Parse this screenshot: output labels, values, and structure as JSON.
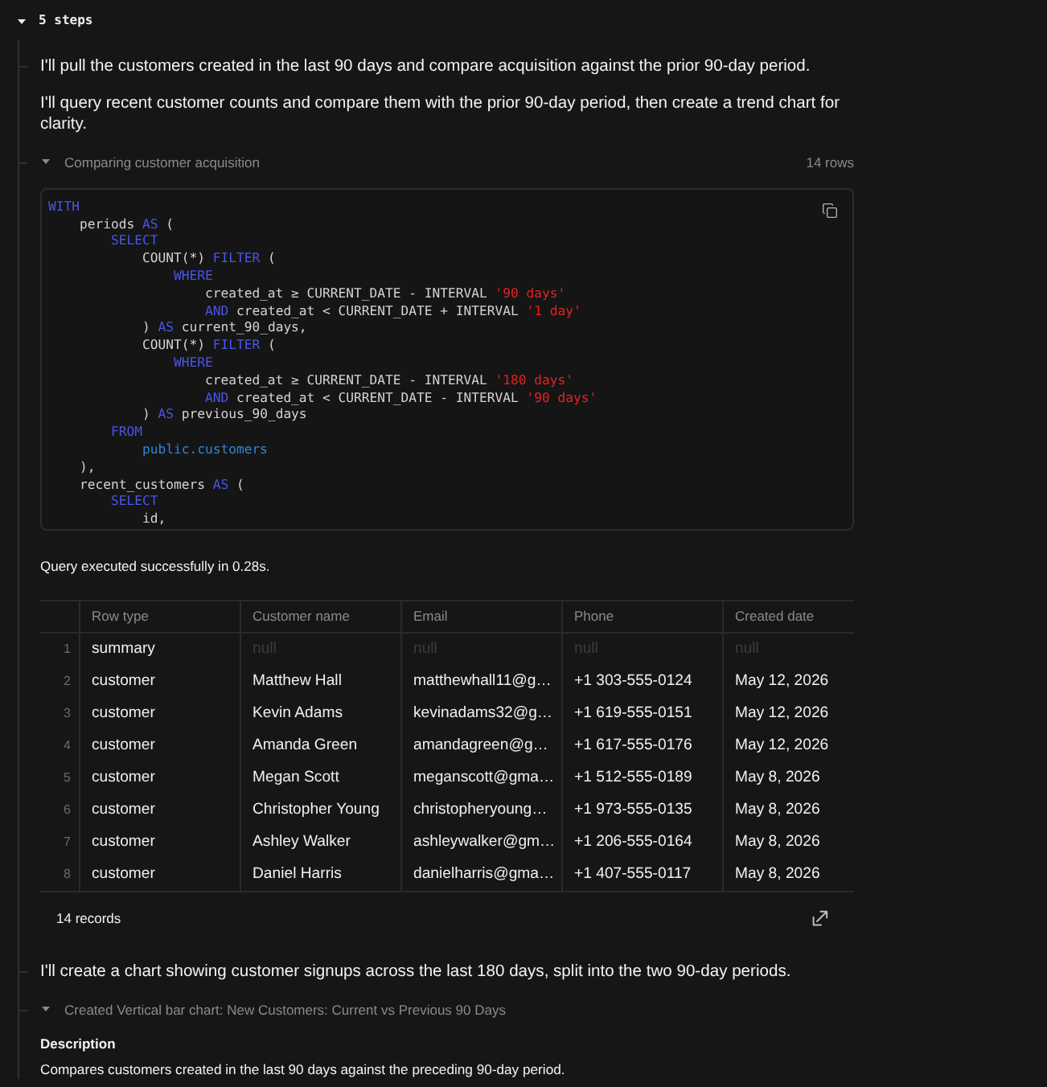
{
  "steps_toggle": {
    "label": "5 steps",
    "expanded": true
  },
  "steps": [
    {
      "kind": "message",
      "paragraphs": [
        "I'll pull the customers created in the last 90 days and compare acquisition against the prior 90-day period.",
        "I'll query recent customer counts and compare them with the prior 90-day period, then create a trend chart for clarity."
      ]
    },
    {
      "kind": "query",
      "title": "Comparing customer acquisition",
      "expanded": true,
      "row_count": "14 rows",
      "code": [
        {
          "tokens": [
            {
              "kind": "keyword",
              "text": "WITH"
            }
          ],
          "children": [
            {
              "tokens": [
                {
                  "kind": "plain",
                  "text": "periods "
                },
                {
                  "kind": "keyword",
                  "text": "AS"
                },
                {
                  "kind": "plain",
                  "text": " ("
                }
              ],
              "children": [
                {
                  "tokens": [
                    {
                      "kind": "keyword",
                      "text": "SELECT"
                    }
                  ],
                  "children": [
                    {
                      "tokens": [
                        {
                          "kind": "plain",
                          "text": "COUNT(*) "
                        },
                        {
                          "kind": "keyword",
                          "text": "FILTER"
                        },
                        {
                          "kind": "plain",
                          "text": " ("
                        }
                      ],
                      "children": [
                        {
                          "tokens": [
                            {
                              "kind": "keyword",
                              "text": "WHERE"
                            }
                          ],
                          "children": [
                            {
                              "tokens": [
                                {
                                  "kind": "plain",
                                  "text": "created_at ≥ CURRENT_DATE - INTERVAL "
                                },
                                {
                                  "kind": "string",
                                  "text": "'90 days'"
                                }
                              ]
                            },
                            {
                              "tokens": [
                                {
                                  "kind": "keyword",
                                  "text": "AND"
                                },
                                {
                                  "kind": "plain",
                                  "text": " created_at < CURRENT_DATE + INTERVAL "
                                },
                                {
                                  "kind": "string",
                                  "text": "'1 day'"
                                }
                              ]
                            }
                          ]
                        }
                      ]
                    },
                    {
                      "tokens": [
                        {
                          "kind": "plain",
                          "text": ") "
                        },
                        {
                          "kind": "keyword",
                          "text": "AS"
                        },
                        {
                          "kind": "plain",
                          "text": " current_90_days,"
                        }
                      ]
                    },
                    {
                      "tokens": [
                        {
                          "kind": "plain",
                          "text": "COUNT(*) "
                        },
                        {
                          "kind": "keyword",
                          "text": "FILTER"
                        },
                        {
                          "kind": "plain",
                          "text": " ("
                        }
                      ],
                      "children": [
                        {
                          "tokens": [
                            {
                              "kind": "keyword",
                              "text": "WHERE"
                            }
                          ],
                          "children": [
                            {
                              "tokens": [
                                {
                                  "kind": "plain",
                                  "text": "created_at ≥ CURRENT_DATE - INTERVAL "
                                },
                                {
                                  "kind": "string",
                                  "text": "'180 days'"
                                }
                              ]
                            },
                            {
                              "tokens": [
                                {
                                  "kind": "keyword",
                                  "text": "AND"
                                },
                                {
                                  "kind": "plain",
                                  "text": " created_at < CURRENT_DATE - INTERVAL "
                                },
                                {
                                  "kind": "string",
                                  "text": "'90 days'"
                                }
                              ]
                            }
                          ]
                        }
                      ]
                    },
                    {
                      "tokens": [
                        {
                          "kind": "plain",
                          "text": ") "
                        },
                        {
                          "kind": "keyword",
                          "text": "AS"
                        },
                        {
                          "kind": "plain",
                          "text": " previous_90_days"
                        }
                      ]
                    }
                  ]
                },
                {
                  "tokens": [
                    {
                      "kind": "keyword",
                      "text": "FROM"
                    }
                  ],
                  "children": [
                    {
                      "tokens": [
                        {
                          "kind": "reference",
                          "text": "public.customers"
                        }
                      ]
                    }
                  ]
                }
              ]
            },
            {
              "tokens": [
                {
                  "kind": "plain",
                  "text": "),"
                }
              ]
            },
            {
              "tokens": [
                {
                  "kind": "plain",
                  "text": "recent_customers "
                },
                {
                  "kind": "keyword",
                  "text": "AS"
                },
                {
                  "kind": "plain",
                  "text": " ("
                }
              ],
              "children": [
                {
                  "tokens": [
                    {
                      "kind": "keyword",
                      "text": "SELECT"
                    }
                  ],
                  "children": [
                    {
                      "tokens": [
                        {
                          "kind": "plain",
                          "text": "id,"
                        }
                      ]
                    }
                  ]
                }
              ]
            }
          ]
        }
      ],
      "status": "Query executed successfully in 0.28s.",
      "table": {
        "columns": [
          "Row type",
          "Customer name",
          "Email",
          "Phone",
          "Created date"
        ],
        "rows": [
          {
            "number": "1",
            "cells": [
              {
                "kind": "value",
                "text": "summary"
              },
              {
                "kind": "null",
                "text": "null"
              },
              {
                "kind": "null",
                "text": "null"
              },
              {
                "kind": "null",
                "text": "null"
              },
              {
                "kind": "null",
                "text": "null"
              }
            ]
          },
          {
            "number": "2",
            "cells": [
              {
                "kind": "value",
                "text": "customer"
              },
              {
                "kind": "value",
                "text": "Matthew Hall"
              },
              {
                "kind": "value",
                "text": "matthewhall11@g…"
              },
              {
                "kind": "value",
                "text": "+1 303-555-0124"
              },
              {
                "kind": "value",
                "text": "May 12, 2026"
              }
            ]
          },
          {
            "number": "3",
            "cells": [
              {
                "kind": "value",
                "text": "customer"
              },
              {
                "kind": "value",
                "text": "Kevin Adams"
              },
              {
                "kind": "value",
                "text": "kevinadams32@g…"
              },
              {
                "kind": "value",
                "text": "+1 619-555-0151"
              },
              {
                "kind": "value",
                "text": "May 12, 2026"
              }
            ]
          },
          {
            "number": "4",
            "cells": [
              {
                "kind": "value",
                "text": "customer"
              },
              {
                "kind": "value",
                "text": "Amanda Green"
              },
              {
                "kind": "value",
                "text": "amandagreen@g…"
              },
              {
                "kind": "value",
                "text": "+1 617-555-0176"
              },
              {
                "kind": "value",
                "text": "May 12, 2026"
              }
            ]
          },
          {
            "number": "5",
            "cells": [
              {
                "kind": "value",
                "text": "customer"
              },
              {
                "kind": "value",
                "text": "Megan Scott"
              },
              {
                "kind": "value",
                "text": "meganscott@gma…"
              },
              {
                "kind": "value",
                "text": "+1 512-555-0189"
              },
              {
                "kind": "value",
                "text": "May 8, 2026"
              }
            ]
          },
          {
            "number": "6",
            "cells": [
              {
                "kind": "value",
                "text": "customer"
              },
              {
                "kind": "value",
                "text": "Christopher Young"
              },
              {
                "kind": "value",
                "text": "christopheryoung…"
              },
              {
                "kind": "value",
                "text": "+1 973-555-0135"
              },
              {
                "kind": "value",
                "text": "May 8, 2026"
              }
            ]
          },
          {
            "number": "7",
            "cells": [
              {
                "kind": "value",
                "text": "customer"
              },
              {
                "kind": "value",
                "text": "Ashley Walker"
              },
              {
                "kind": "value",
                "text": "ashleywalker@gm…"
              },
              {
                "kind": "value",
                "text": "+1 206-555-0164"
              },
              {
                "kind": "value",
                "text": "May 8, 2026"
              }
            ]
          },
          {
            "number": "8",
            "cells": [
              {
                "kind": "value",
                "text": "customer"
              },
              {
                "kind": "value",
                "text": "Daniel Harris"
              },
              {
                "kind": "value",
                "text": "danielharris@gma…"
              },
              {
                "kind": "value",
                "text": "+1 407-555-0117"
              },
              {
                "kind": "value",
                "text": "May 8, 2026"
              }
            ]
          }
        ]
      },
      "footer": "14 records"
    },
    {
      "kind": "message",
      "paragraphs": [
        "I'll create a chart showing customer signups across the last 180 days, split into the two 90-day periods."
      ]
    },
    {
      "kind": "chart",
      "title": "Created Vertical bar chart: New Customers: Current vs Previous 90 Days",
      "expanded": true,
      "description_label": "Description",
      "description": "Compares customers created in the last 90 days against the preceding 90-day period."
    }
  ]
}
